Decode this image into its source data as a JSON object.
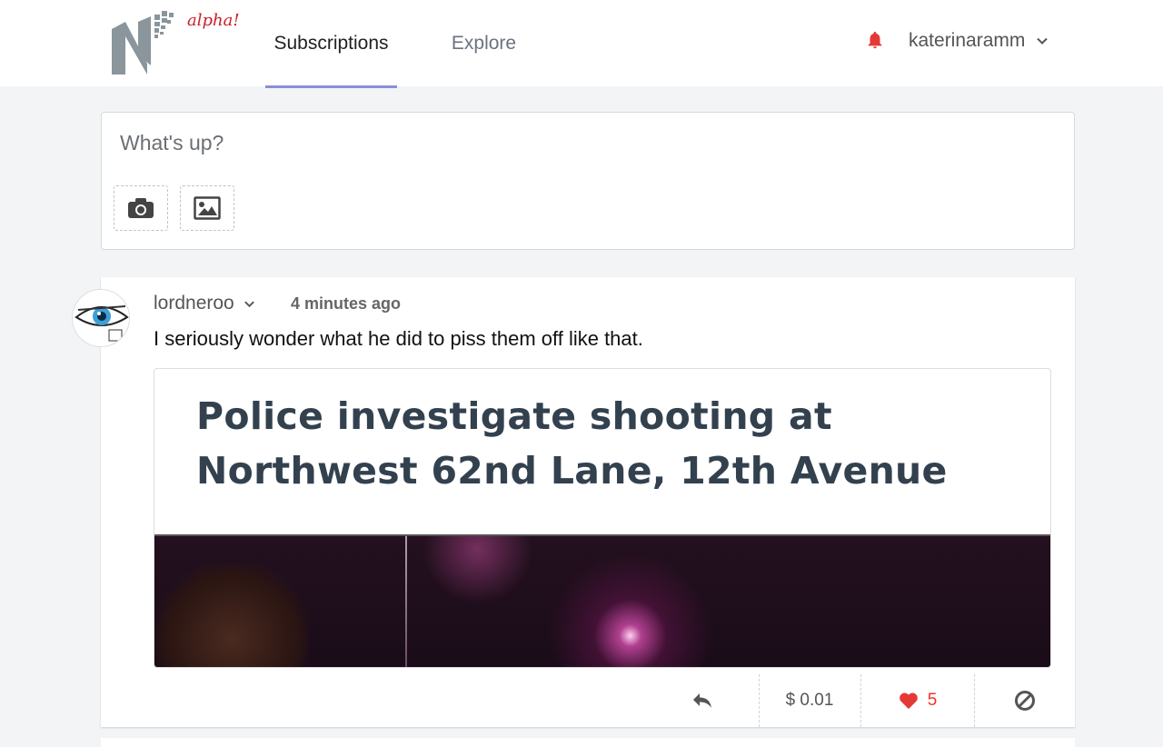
{
  "header": {
    "logo_text": "alpha!",
    "tabs": [
      {
        "label": "Subscriptions",
        "active": true
      },
      {
        "label": "Explore",
        "active": false
      }
    ],
    "username": "katerinaramm",
    "accent_color": "#8b8fd6",
    "bell_color": "#e53935"
  },
  "composer": {
    "placeholder": "What's up?",
    "icons": [
      "camera-icon",
      "image-icon"
    ]
  },
  "post": {
    "author": "lordneroo",
    "time": "4 minutes ago",
    "text": "I seriously wonder what he did to piss them off like that.",
    "image_headline": "Police investigate shooting at Northwest 62nd Lane, 12th Avenue",
    "actions": {
      "tip": "$ 0.01",
      "likes": "5"
    }
  }
}
